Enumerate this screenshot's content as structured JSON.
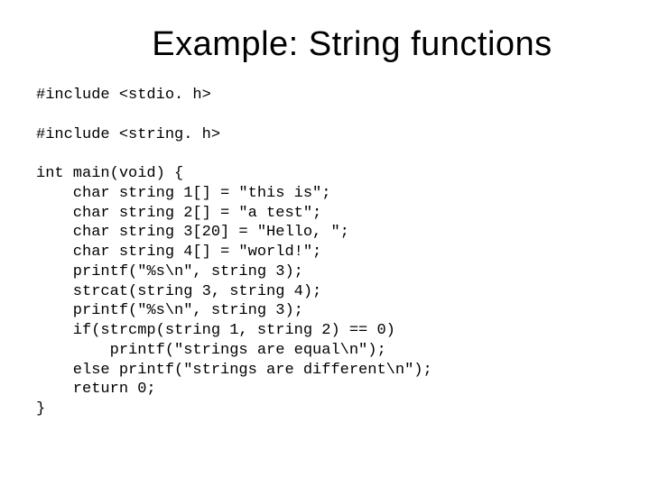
{
  "title": "Example: String functions",
  "code": {
    "l01": "#include <stdio. h>",
    "l02": "",
    "l03": "#include <string. h>",
    "l04": "",
    "l05": "int main(void) {",
    "l06": "    char string 1[] = \"this is\";",
    "l07": "    char string 2[] = \"a test\";",
    "l08": "    char string 3[20] = \"Hello, \";",
    "l09": "    char string 4[] = \"world!\";",
    "l10": "    printf(\"%s\\n\", string 3);",
    "l11": "    strcat(string 3, string 4);",
    "l12": "    printf(\"%s\\n\", string 3);",
    "l13": "    if(strcmp(string 1, string 2) == 0)",
    "l14": "        printf(\"strings are equal\\n\");",
    "l15": "    else printf(\"strings are different\\n\");",
    "l16": "    return 0;",
    "l17": "}"
  }
}
